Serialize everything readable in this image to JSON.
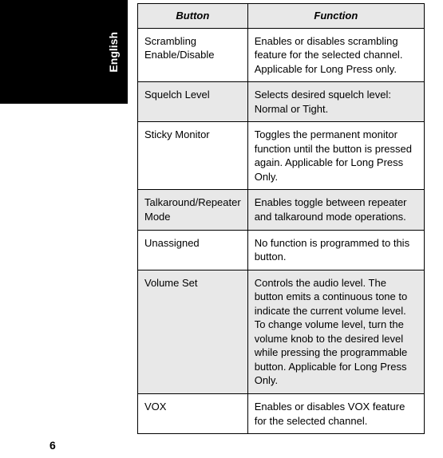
{
  "language_tab": "English",
  "page_number": "6",
  "table": {
    "headers": {
      "button": "Button",
      "function": "Function"
    },
    "rows": [
      {
        "button": "Scrambling Enable/Disable",
        "function": "Enables or disables scrambling feature for the selected channel. Applicable for Long Press only."
      },
      {
        "button": "Squelch Level",
        "function": "Selects desired squelch level: Normal or Tight."
      },
      {
        "button": "Sticky Monitor",
        "function": "Toggles the permanent monitor function until the button is pressed again. Applicable for Long Press Only."
      },
      {
        "button": "Talkaround/Repeater Mode",
        "function": "Enables toggle between repeater and talkaround mode operations."
      },
      {
        "button": "Unassigned",
        "function": "No function is programmed to this button."
      },
      {
        "button": "Volume Set",
        "function": "Controls the audio level. The button emits a continuous tone to indicate the current  volume level. To change volume level, turn the volume knob to the desired level while pressing the programmable button. Applicable for Long Press Only."
      },
      {
        "button": "VOX",
        "function": "Enables or disables VOX feature for the selected channel."
      }
    ]
  }
}
